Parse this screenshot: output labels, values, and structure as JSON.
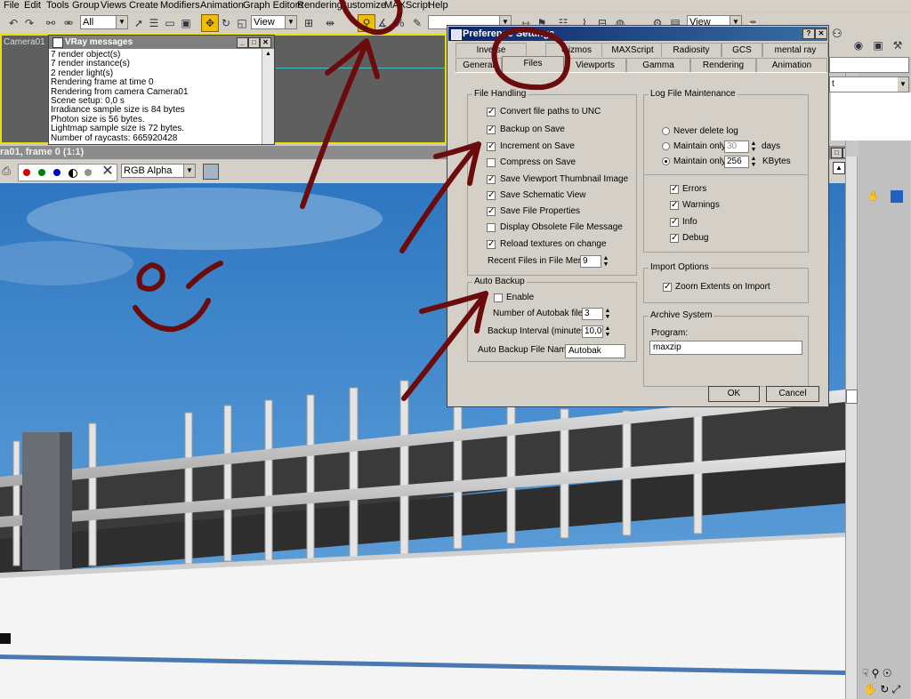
{
  "menu": [
    "File",
    "Edit",
    "Tools",
    "Group",
    "Views",
    "Create",
    "Modifiers",
    "Animation",
    "Graph Editors",
    "Rendering",
    "Customize",
    "MAXScript",
    "Help"
  ],
  "toolbar": {
    "selection_filter": "All",
    "ref_coord": "View",
    "ref_coord_right": "View"
  },
  "viewport": {
    "label": "Camera01"
  },
  "vray": {
    "title": "VRay messages",
    "lines": [
      "7 render object(s)",
      "7 render instance(s)",
      "2 render light(s)",
      "Rendering frame at time 0",
      "Rendering from camera Camera01",
      "Scene setup: 0,0 s",
      "Irradiance sample size is 84 bytes",
      "Photon size is 56 bytes.",
      "Lightmap sample size is 72 bytes.",
      "Number of raycasts: 665920428"
    ]
  },
  "framebuffer": {
    "title": "ra01, frame 0 (1:1)",
    "channel": "RGB Alpha"
  },
  "right_panel": {
    "dropdown": "t"
  },
  "dialog": {
    "title": "Preference Settings",
    "help_button": "?",
    "close_button": "✕",
    "tabs_row1": [
      "Inverse Kinematics",
      "Gizmos",
      "MAXScript",
      "Radiosity",
      "GCS",
      "mental ray"
    ],
    "tabs_row2": [
      "General",
      "Files",
      "Viewports",
      "Gamma",
      "Rendering",
      "Animation"
    ],
    "active_tab": "Files",
    "file_handling": {
      "legend": "File Handling",
      "items": [
        {
          "label": "Convert file paths to UNC",
          "checked": true
        },
        {
          "label": "Backup on Save",
          "checked": true
        },
        {
          "label": "Increment on Save",
          "checked": true
        },
        {
          "label": "Compress on Save",
          "checked": false
        },
        {
          "label": "Save Viewport Thumbnail Image",
          "checked": true
        },
        {
          "label": "Save Schematic View",
          "checked": true
        },
        {
          "label": "Save File Properties",
          "checked": true
        },
        {
          "label": "Display Obsolete File Message",
          "checked": false
        },
        {
          "label": "Reload textures on change",
          "checked": true
        }
      ],
      "recent_label": "Recent Files in File Menu:",
      "recent_value": "9"
    },
    "auto_backup": {
      "legend": "Auto Backup",
      "enable_label": "Enable",
      "enabled": false,
      "num_files_label": "Number of Autobak files:",
      "num_files": "3",
      "interval_label": "Backup Interval (minutes):",
      "interval": "10,0",
      "name_label": "Auto Backup File Name:",
      "name": "Autobak"
    },
    "log": {
      "legend": "Log File Maintenance",
      "never": "Never delete log",
      "maintain_days_label": "Maintain only",
      "days_value": "30",
      "days_unit": "days",
      "maintain_kb_label": "Maintain only",
      "kb_value": "256",
      "kb_unit": "KBytes",
      "selected": "kbytes",
      "checks": [
        {
          "label": "Errors",
          "checked": true
        },
        {
          "label": "Warnings",
          "checked": true
        },
        {
          "label": "Info",
          "checked": true
        },
        {
          "label": "Debug",
          "checked": true
        }
      ]
    },
    "import": {
      "legend": "Import Options",
      "zoom_label": "Zoom Extents on Import",
      "zoom_checked": true
    },
    "archive": {
      "legend": "Archive System",
      "program_label": "Program:",
      "program": "maxzip"
    },
    "ok": "OK",
    "cancel": "Cancel"
  },
  "colors": {
    "annotation": "#6b0b0b",
    "title_bar": "#0a246a",
    "viewport_border": "#e8e000"
  }
}
